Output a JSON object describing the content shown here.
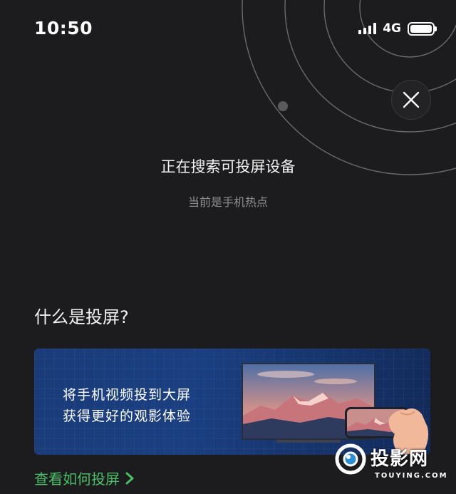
{
  "status_bar": {
    "time": "10:50",
    "network": "4G"
  },
  "search": {
    "title": "正在搜索可投屏设备",
    "subtitle": "当前是手机热点"
  },
  "section": {
    "title": "什么是投屏?"
  },
  "banner": {
    "line1": "将手机视频投到大屏",
    "line2": "获得更好的观影体验"
  },
  "how_link": {
    "label": "查看如何投屏"
  },
  "watermark": {
    "name": "投影网",
    "domain": "TOUYING.COM"
  },
  "colors": {
    "background": "#1c1c1e",
    "accent_green": "#4cc068",
    "banner_blue": "#1b3f80"
  }
}
